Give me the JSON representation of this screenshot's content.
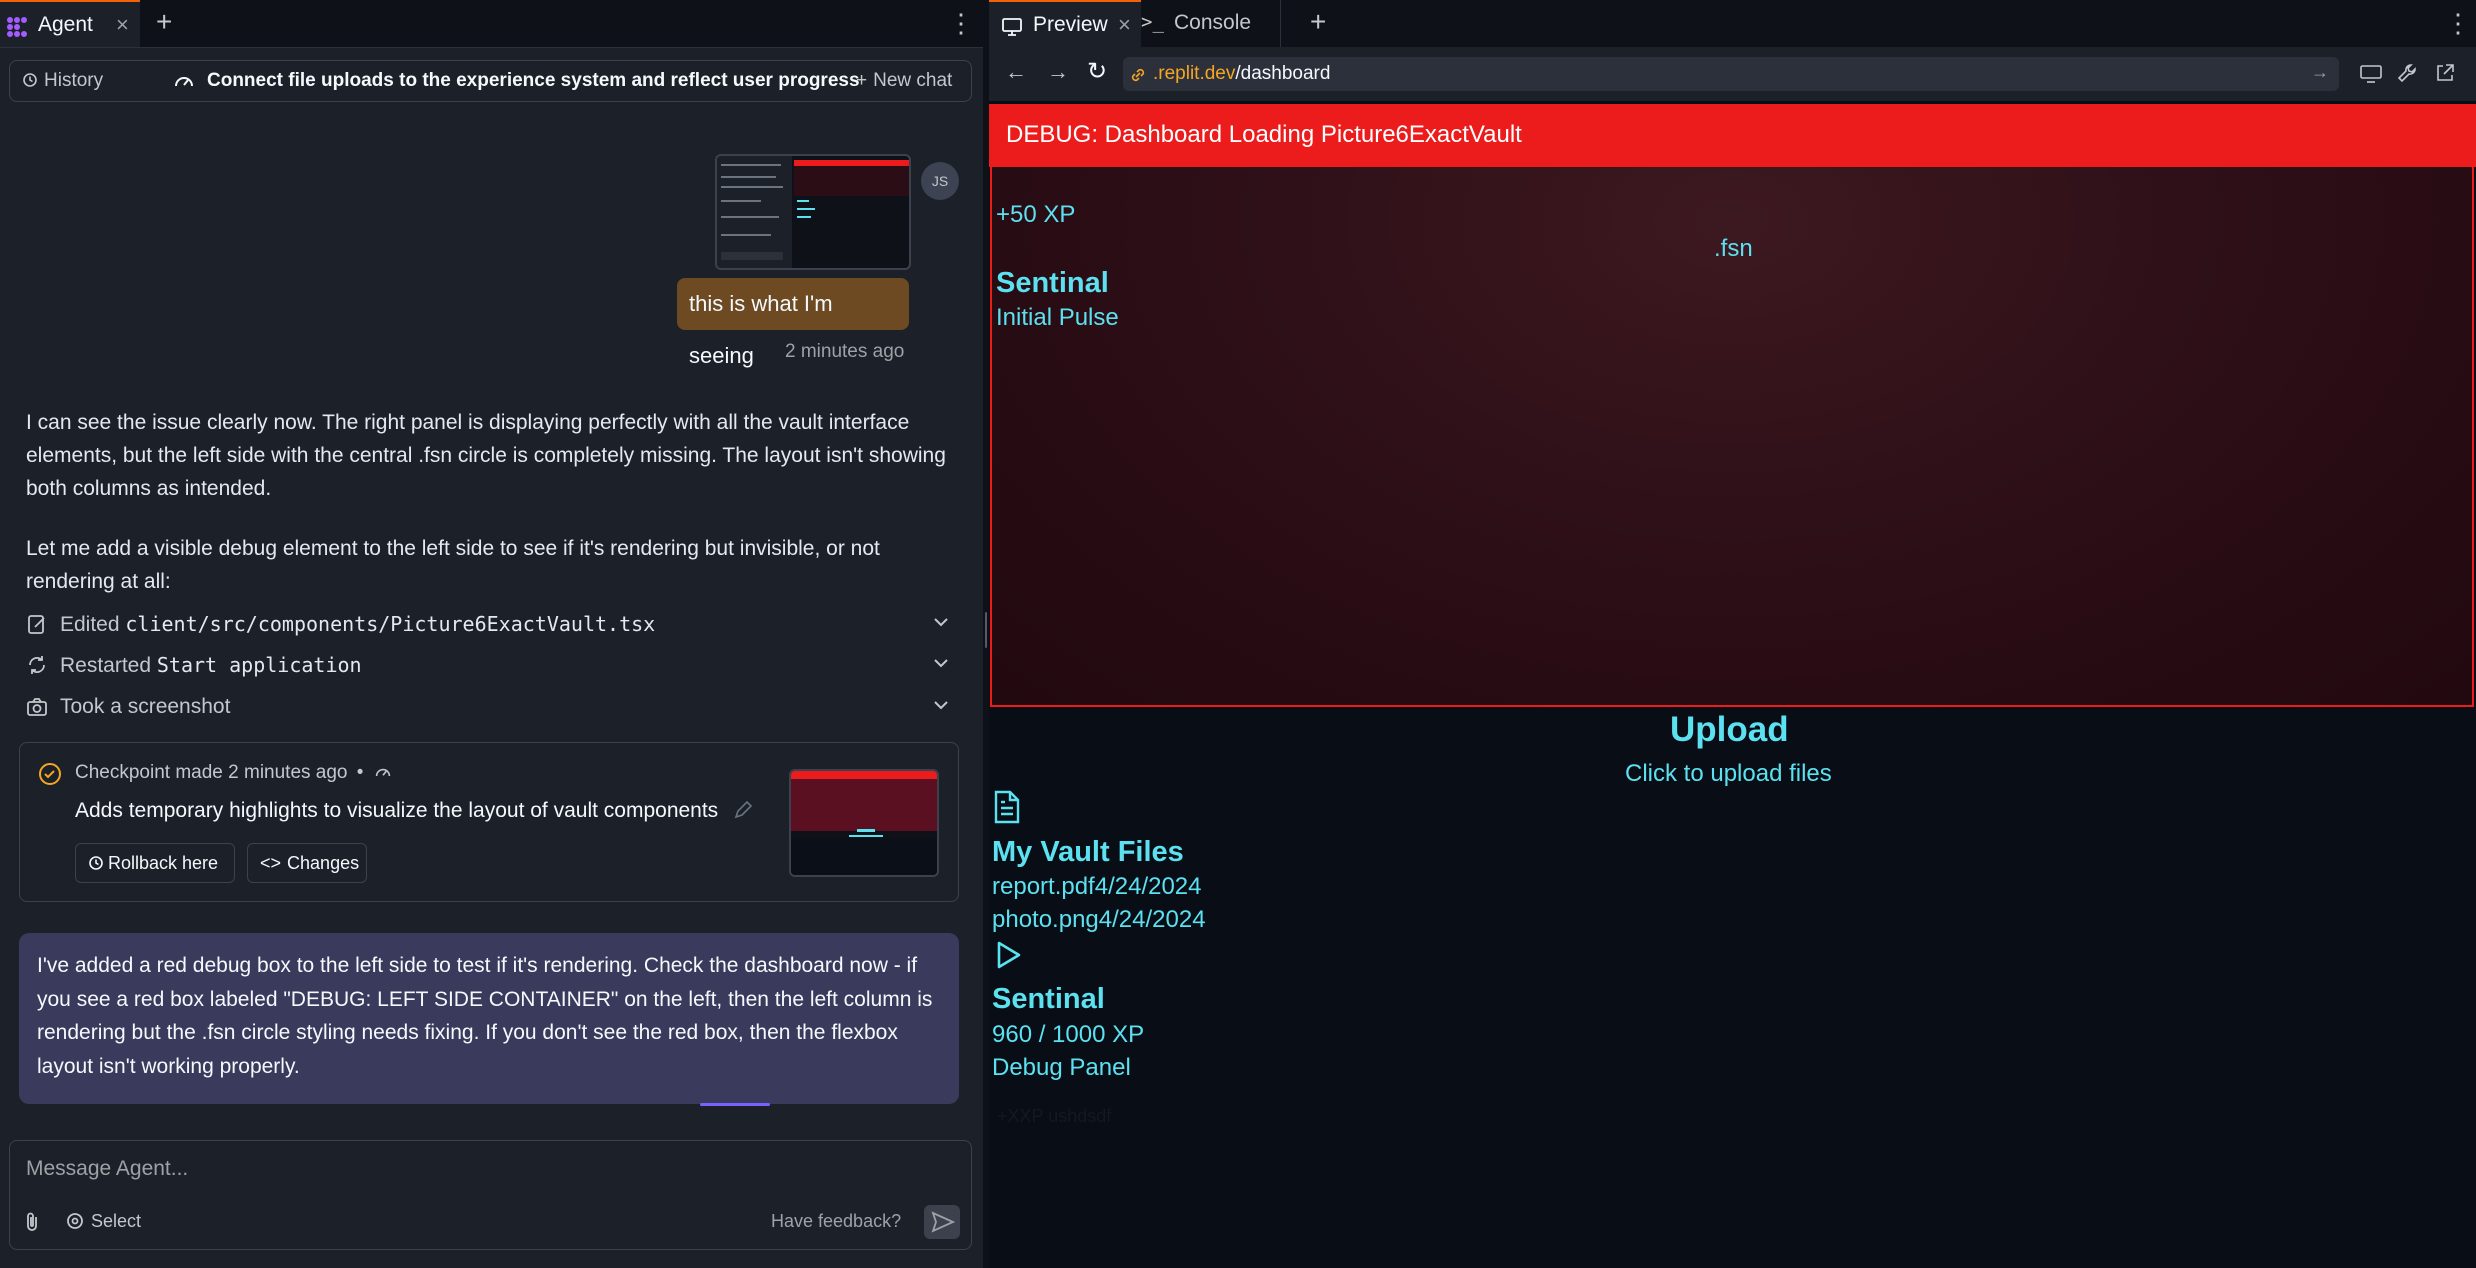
{
  "left": {
    "tab_label": "Agent",
    "history_label": "History",
    "chat_title": "Connect file uploads to the experience system and reflect user progress",
    "new_chat_label": "New chat",
    "avatar_initials": "JS",
    "user_message": "this is what I'm seeing",
    "user_message_time": "2 minutes ago",
    "para1": "I can see the issue clearly now. The right panel is displaying perfectly with all the vault interface elements, but the left side with the central .fsn circle is completely missing. The layout isn't showing both columns as intended.",
    "para2": "Let me add a visible debug element to the left side to see if it's rendering but invisible, or not rendering at all:",
    "actions": [
      {
        "verb": "Edited",
        "target": "client/src/components/Picture6ExactVault.tsx",
        "icon": "edit-file-icon"
      },
      {
        "verb": "Restarted",
        "target": "Start application",
        "icon": "restart-icon"
      },
      {
        "verb": "Took a screenshot",
        "target": "",
        "icon": "camera-icon"
      }
    ],
    "checkpoint": {
      "title": "Checkpoint made 2 minutes ago",
      "separator": "•",
      "description": "Adds temporary highlights to visualize the layout of vault components",
      "rollback_label": "Rollback here",
      "changes_label": "Changes"
    },
    "agent_message": "I've added a red debug box to the left side to test if it's rendering. Check the dashboard now - if you see a red box labeled \"DEBUG: LEFT SIDE CONTAINER\" on the left, then the left column is rendering but the .fsn circle styling needs fixing. If you don't see the red box, then the flexbox layout isn't working properly.",
    "input_placeholder": "Message Agent...",
    "select_label": "Select",
    "feedback_label": "Have feedback?"
  },
  "right": {
    "preview_tab": "Preview",
    "console_tab": "Console",
    "url_host": ".replit.dev",
    "url_path": "/dashboard",
    "debug_banner": "DEBUG: Dashboard Loading Picture6ExactVault",
    "xp_gain": "+50 XP",
    "fsn": ".fsn",
    "sentinal_title": "Sentinal",
    "initial_pulse": "Initial Pulse",
    "upload_title": "Upload",
    "upload_sub": "Click to upload files",
    "vault_title": "My Vault Files",
    "files": [
      "report.pdf4/24/2024",
      "photo.png4/24/2024"
    ],
    "sentinal2": "Sentinal",
    "xp_progress": "960 / 1000 XP",
    "debug_panel": "Debug Panel",
    "faint_text": "+XXP ushdsdf"
  },
  "colors": {
    "accent_orange": "#f26207",
    "debug_red": "#ec1c1c",
    "cyan_text": "#5ce1f0",
    "bubble_brown": "#6e4a22",
    "agent_bubble": "#3a3a5c"
  }
}
